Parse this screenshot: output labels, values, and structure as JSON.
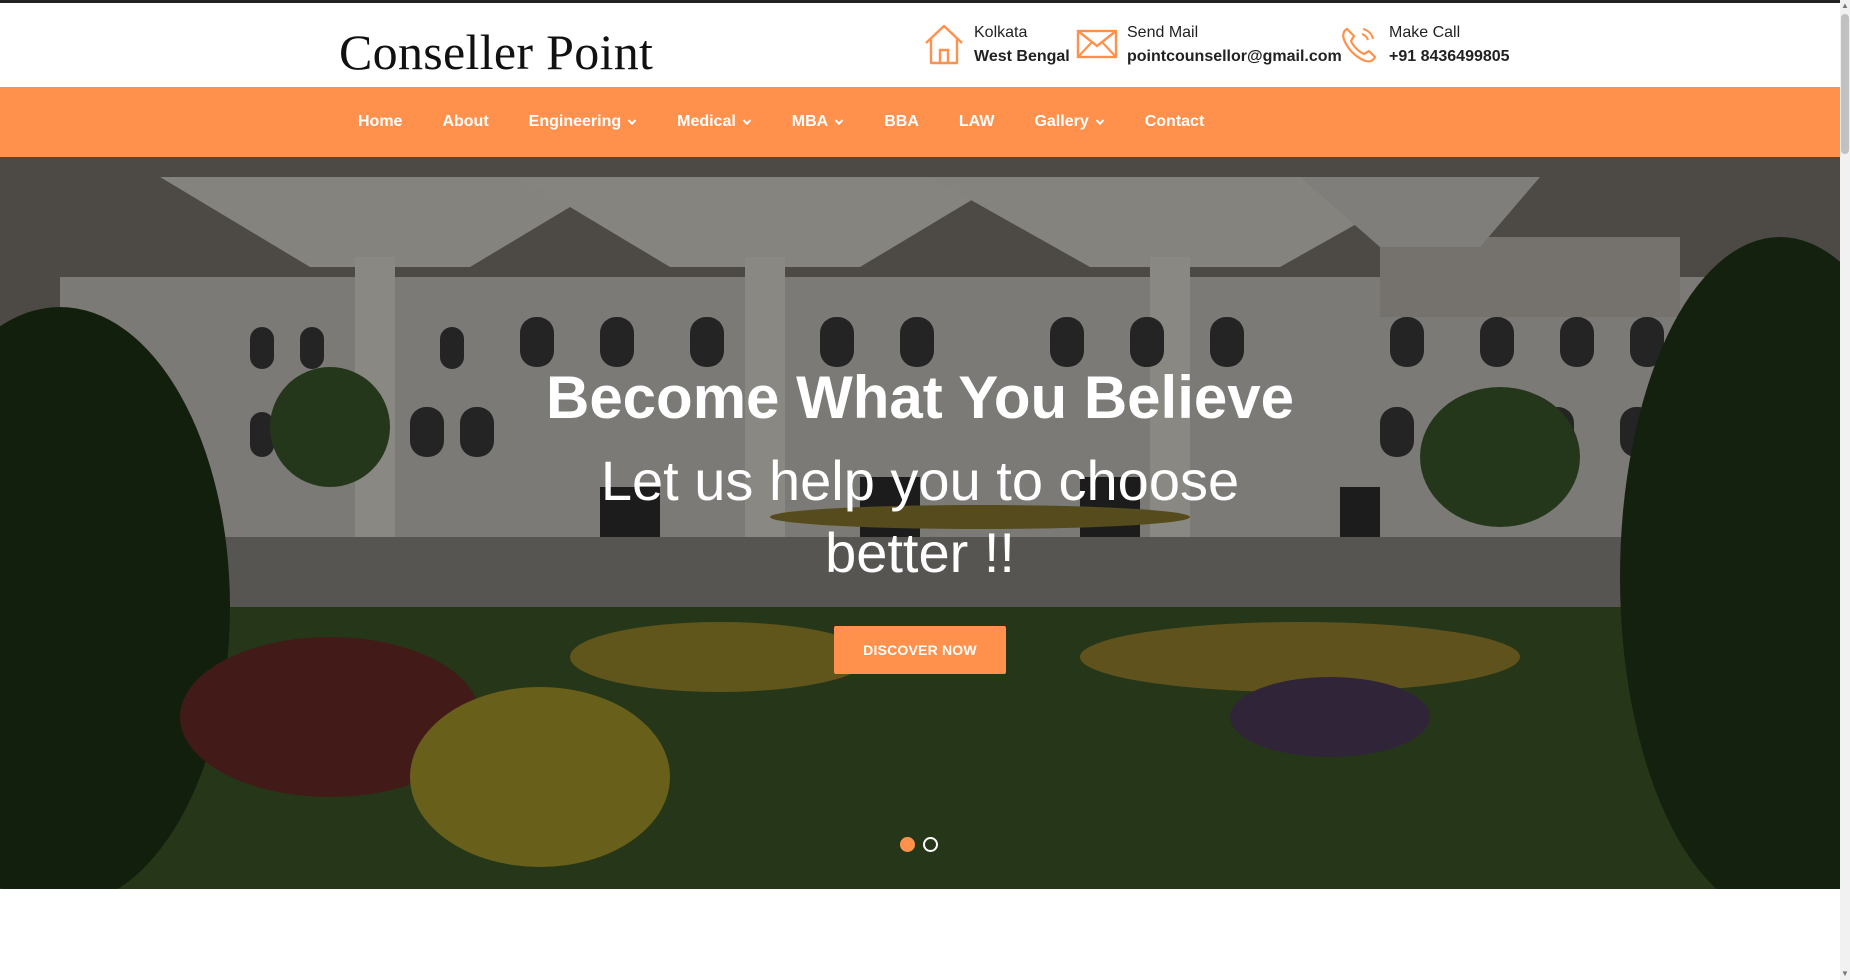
{
  "brand": {
    "logo_text": "Conseller Point"
  },
  "header": {
    "contacts": [
      {
        "icon": "home-icon",
        "line1": "Kolkata",
        "line2": "West Bengal"
      },
      {
        "icon": "mail-icon",
        "line1": "Send Mail",
        "line2": "pointcounsellor@gmail.com"
      },
      {
        "icon": "phone-icon",
        "line1": "Make Call",
        "line2": "+91 8436499805"
      }
    ]
  },
  "nav": {
    "items": [
      {
        "label": "Home",
        "dropdown": false
      },
      {
        "label": "About",
        "dropdown": false
      },
      {
        "label": "Engineering",
        "dropdown": true
      },
      {
        "label": "Medical",
        "dropdown": true
      },
      {
        "label": "MBA",
        "dropdown": true
      },
      {
        "label": "BBA",
        "dropdown": false
      },
      {
        "label": "LAW",
        "dropdown": false
      },
      {
        "label": "Gallery",
        "dropdown": true
      },
      {
        "label": "Contact",
        "dropdown": false
      }
    ]
  },
  "hero": {
    "title": "Become What You Believe",
    "subtitle": "Let us help you to choose better !!",
    "cta_label": "DISCOVER NOW",
    "slides_total": 2,
    "slide_active": 1
  },
  "colors": {
    "accent": "#ff914d",
    "nav_text": "#ffffff",
    "hero_text": "#ffffff"
  }
}
